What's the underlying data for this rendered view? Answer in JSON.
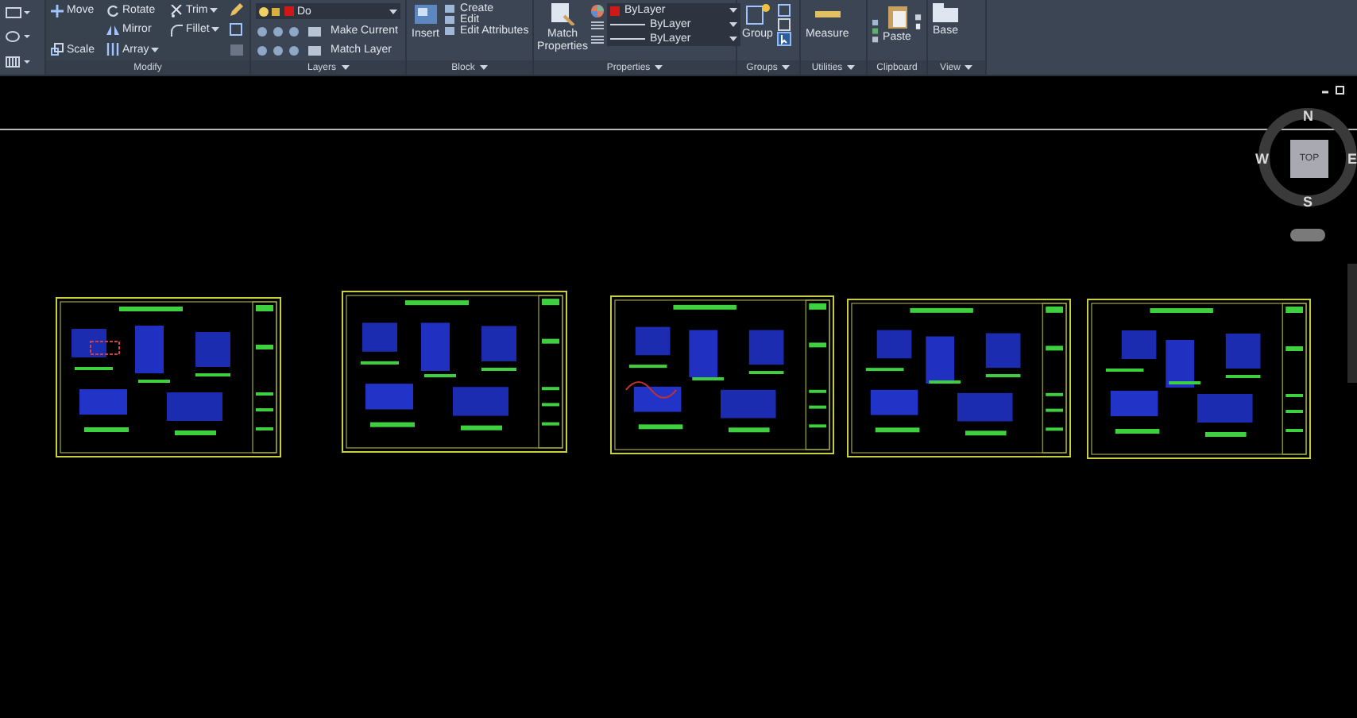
{
  "ribbon": {
    "modify": {
      "title": "Modify",
      "tools": [
        {
          "label": "Move",
          "kind": "move",
          "dropdown": false
        },
        {
          "label": "Rotate",
          "kind": "rotate",
          "dropdown": false
        },
        {
          "label": "Trim",
          "kind": "trim",
          "dropdown": true
        },
        {
          "label": "Mirror",
          "kind": "mirror",
          "dropdown": false
        },
        {
          "label": "Fillet",
          "kind": "fillet",
          "dropdown": true
        },
        {
          "label": "Scale",
          "kind": "scale",
          "dropdown": false
        },
        {
          "label": "Array",
          "kind": "array",
          "dropdown": true
        }
      ]
    },
    "layers": {
      "title": "Layers",
      "layer_name": "Do",
      "buttons": [
        "Make Current",
        "Match Layer"
      ]
    },
    "block": {
      "title": "Block",
      "insert": "Insert",
      "buttons": [
        "Create",
        "Edit",
        "Edit Attributes"
      ]
    },
    "properties": {
      "title": "Properties",
      "match_properties": "Match Properties",
      "dropdowns": [
        "ByLayer",
        "ByLayer",
        "ByLayer"
      ]
    },
    "groups": {
      "title": "Groups",
      "group": "Group"
    },
    "utilities": {
      "title": "Utilities",
      "measure": "Measure"
    },
    "clipboard": {
      "title": "Clipboard",
      "paste": "Paste"
    },
    "view": {
      "title": "View",
      "base": "Base"
    }
  },
  "viewcube": {
    "face": "TOP",
    "north": "N",
    "south": "S",
    "west": "W",
    "east": "E"
  }
}
